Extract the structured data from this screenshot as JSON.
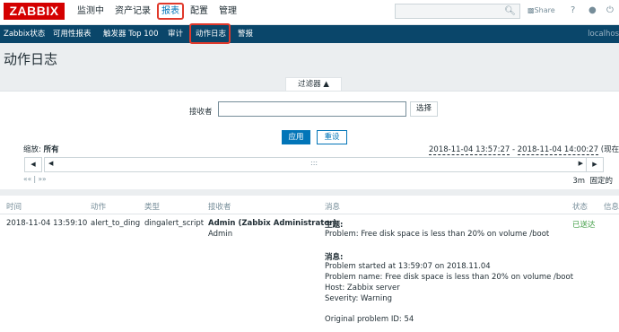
{
  "logo": "ZABBIX",
  "main_menu": [
    "监测中",
    "资产记录",
    "报表",
    "配置",
    "管理"
  ],
  "header_icons": {
    "share": "Share",
    "help": "?"
  },
  "sub_menu": [
    "Zabbix状态",
    "可用性报表",
    "触发器 Top 100",
    "审计",
    "动作日志",
    "警报"
  ],
  "host": "localhos",
  "page_title": "动作日志",
  "filter": {
    "tab_label": "过滤器 ▲",
    "recipients_label": "接收者",
    "recipients_value": "",
    "select_button": "选择",
    "apply_button": "应用",
    "reset_button": "重设",
    "zoom_label": "缩放:",
    "zoom_value": "所有",
    "range_from": "2018-11-04 13:57:27",
    "range_sep": " - ",
    "range_to": "2018-11-04 14:00:27",
    "range_suffix": " (现在!)",
    "nav_links": "«« | »»",
    "period": "3m",
    "fixed_label": "固定的"
  },
  "table": {
    "headers": [
      "时间",
      "动作",
      "类型",
      "接收者",
      "消息",
      "状态",
      "信息"
    ],
    "row": {
      "time": "2018-11-04 13:59:10",
      "action": "alert_to_ding",
      "type": "dingalert_script",
      "recipient_name": "Admin (Zabbix Administrator)",
      "recipient_user": "Admin",
      "subject_label": "主题:",
      "subject": "Problem: Free disk space is less than 20% on volume /boot",
      "message_label": "消息:",
      "message_lines": [
        "Problem started at 13:59:07 on 2018.11.04",
        "Problem name: Free disk space is less than 20% on volume /boot",
        "Host: Zabbix server",
        "Severity: Warning",
        "",
        "Original problem ID: 54"
      ],
      "status": "已送达"
    }
  }
}
